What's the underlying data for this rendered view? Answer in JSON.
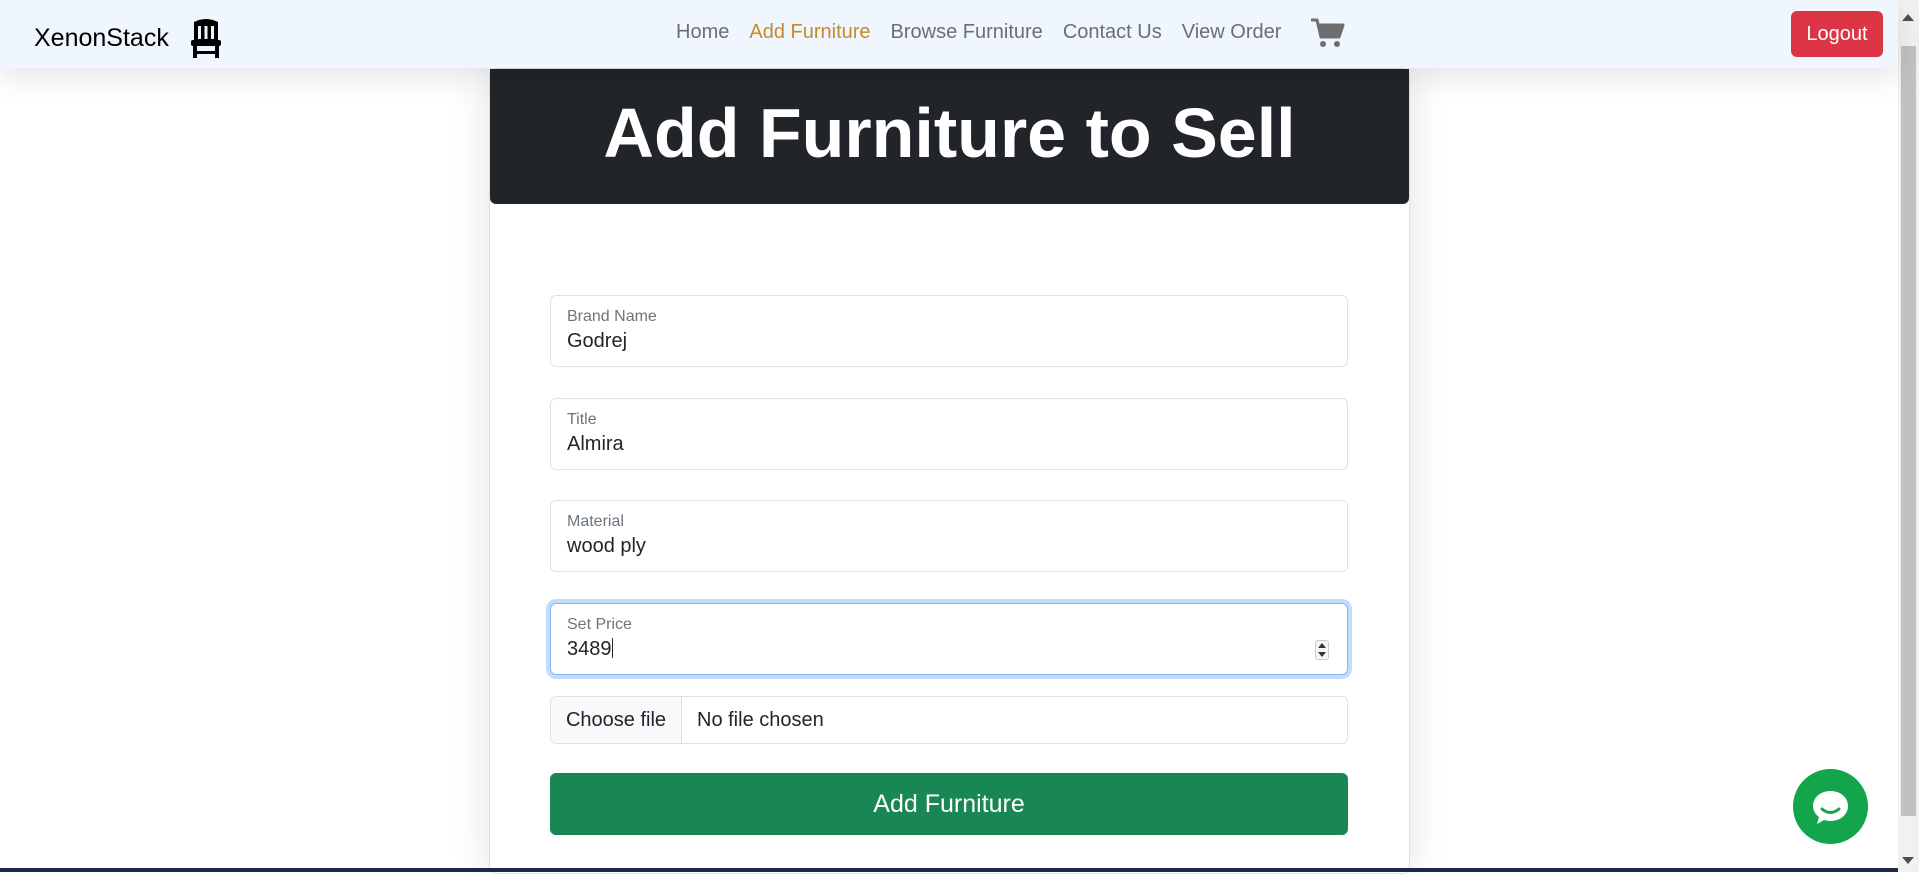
{
  "brand": {
    "name": "XenonStack",
    "icon": "chair-icon"
  },
  "nav": {
    "links": [
      {
        "label": "Home",
        "active": false
      },
      {
        "label": "Add Furniture",
        "active": true
      },
      {
        "label": "Browse Furniture",
        "active": false
      },
      {
        "label": "Contact Us",
        "active": false
      },
      {
        "label": "View Order",
        "active": false
      }
    ],
    "cart_icon": "cart-icon",
    "logout_label": "Logout"
  },
  "form": {
    "title": "Add Furniture to Sell",
    "fields": {
      "brand": {
        "label": "Brand Name",
        "value": "Godrej"
      },
      "title": {
        "label": "Title",
        "value": "Almira"
      },
      "material": {
        "label": "Material",
        "value": "wood ply"
      },
      "price": {
        "label": "Set Price",
        "value": "3489"
      }
    },
    "file": {
      "button_label": "Choose file",
      "status": "No file chosen"
    },
    "submit_label": "Add Furniture"
  },
  "chat": {
    "icon": "chat-bubble-icon"
  },
  "colors": {
    "nav_active": "#c8892b",
    "logout": "#dc3545",
    "submit": "#198754",
    "header_bg": "#212529",
    "chat": "#12a54b"
  }
}
